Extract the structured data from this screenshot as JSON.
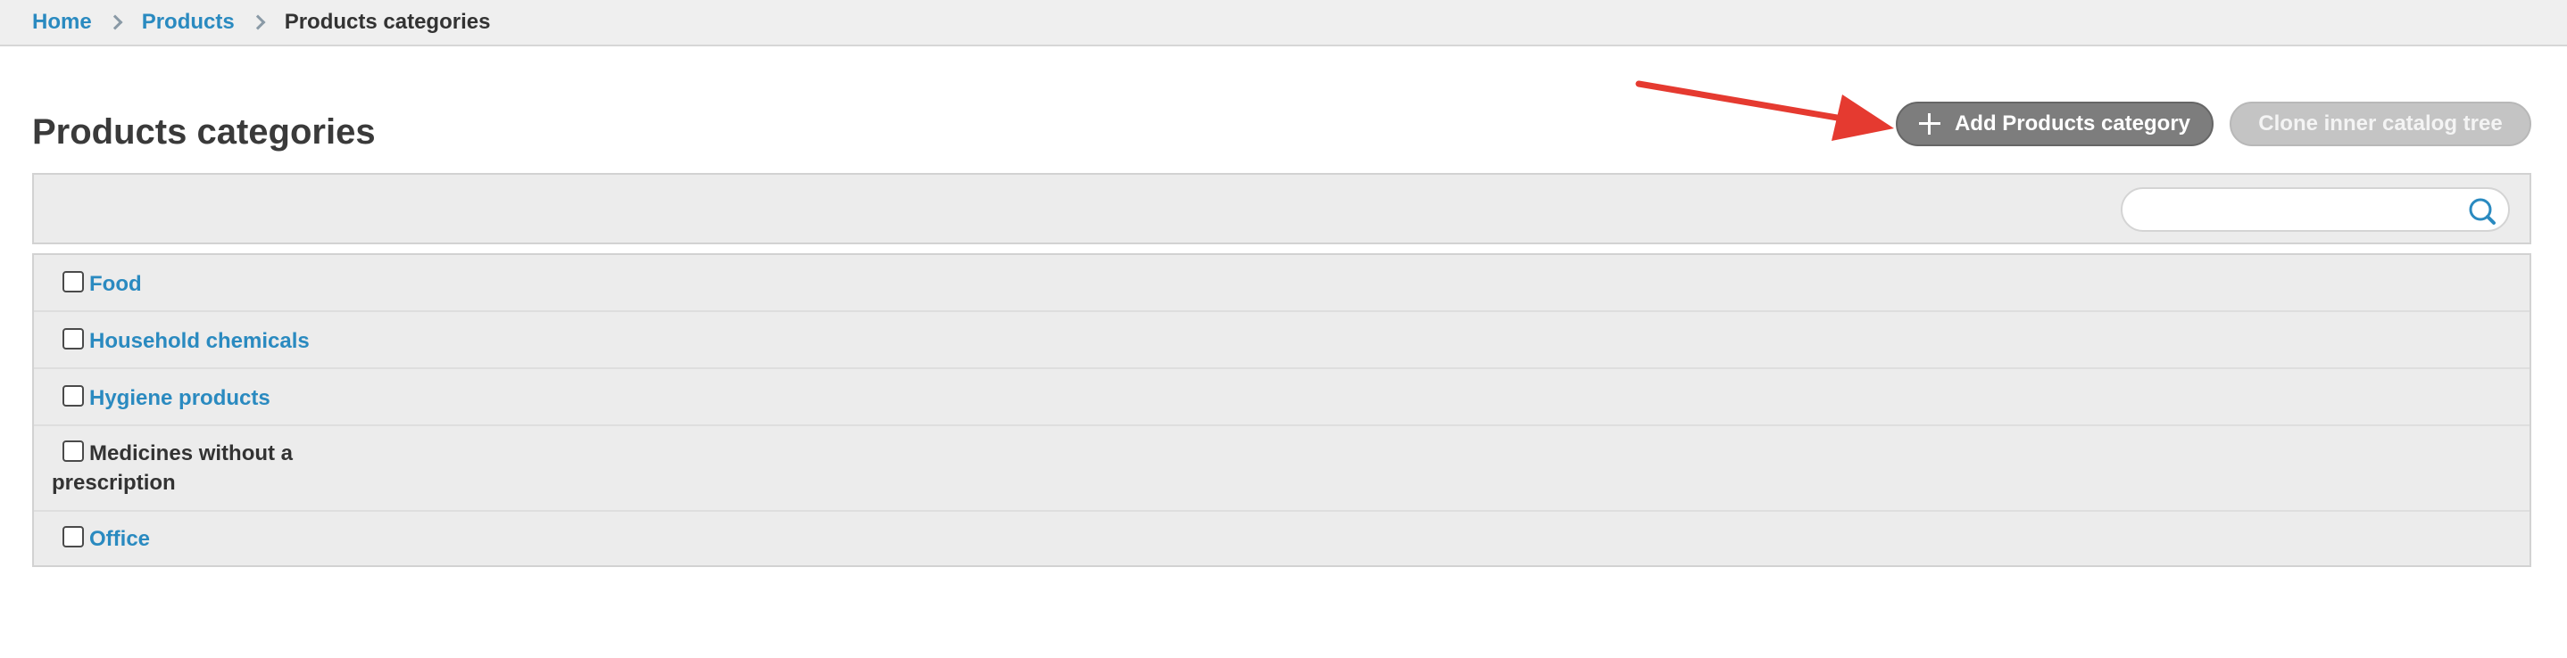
{
  "breadcrumb": {
    "home": "Home",
    "products": "Products",
    "current": "Products categories"
  },
  "page": {
    "title": "Products categories"
  },
  "toolbar": {
    "add_label": "Add Products category",
    "clone_label": "Clone inner catalog tree"
  },
  "search": {
    "value": "",
    "placeholder": ""
  },
  "categories": [
    {
      "label": "Food",
      "is_link": true
    },
    {
      "label": "Household chemicals",
      "is_link": true
    },
    {
      "label": "Hygiene products",
      "is_link": true
    },
    {
      "label": "Medicines without a prescription",
      "is_link": false
    },
    {
      "label": "Office",
      "is_link": true
    }
  ],
  "colors": {
    "link": "#2a8ac0",
    "annotation_arrow": "#e53a30",
    "add_button": "#7d7d7d",
    "clone_button_disabled": "#c4c4c4"
  }
}
